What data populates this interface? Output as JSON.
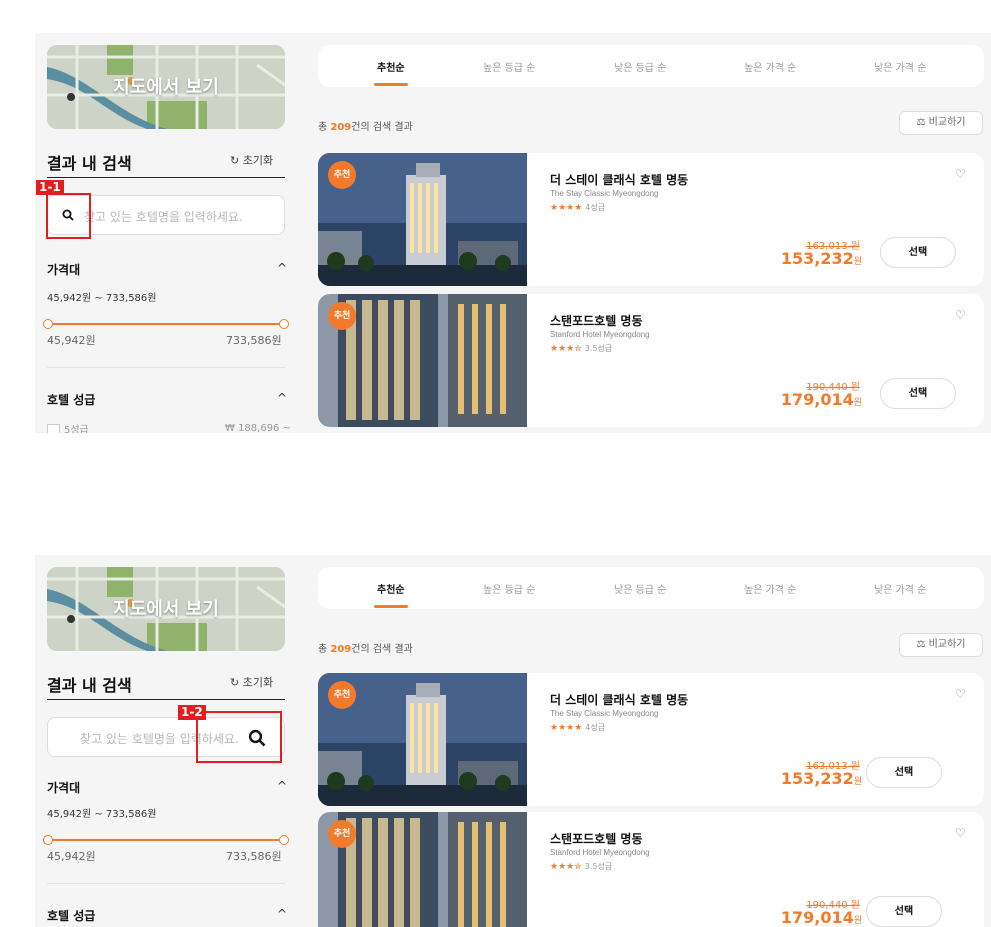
{
  "map": {
    "label": "지도에서 보기"
  },
  "sidebar": {
    "title": "결과 내 검색",
    "reset": "초기화",
    "search_placeholder": "찾고 있는 호텔명을 입력하세요.",
    "price_section": {
      "title": "가격대",
      "range_text": "45,942원 ~ 733,586원",
      "min_label": "45,942원",
      "max_label": "733,586원",
      "min_fraction": 0.0,
      "max_fraction": 1.0
    },
    "grade_section": {
      "title": "호텔 성급",
      "first_option": "5성급",
      "first_option_price": "₩ 188,696 ~"
    }
  },
  "tabs": [
    "추천순",
    "높은 등급 순",
    "낮은 등급 순",
    "높은 가격 순",
    "낮은 가격 순"
  ],
  "active_tab": "추천순",
  "results": {
    "prefix": "총 ",
    "count": "209",
    "suffix": "건의 검색 결과"
  },
  "compare_label": "비교하기",
  "hotels": [
    {
      "badge": "추천",
      "name": "더 스테이 클래식 호텔 명동",
      "name_en": "The Stay Classic Myeongdong",
      "stars": "★★★★",
      "grade": "4성급",
      "old_price": "163,013 원",
      "price": "153,232",
      "currency": "원",
      "select_label": "선택"
    },
    {
      "badge": "추천",
      "name": "스탠포드호텔 명동",
      "name_en": "Stanford Hotel Myeongdong",
      "stars": "★★★✮",
      "grade": "3.5성급",
      "old_price": "190,440 원",
      "price": "179,014",
      "currency": "원",
      "select_label": "선택"
    }
  ],
  "annotations": [
    "1-1",
    "1-2"
  ],
  "colors": {
    "accent": "#f47a2b",
    "annotation": "#e02020"
  }
}
